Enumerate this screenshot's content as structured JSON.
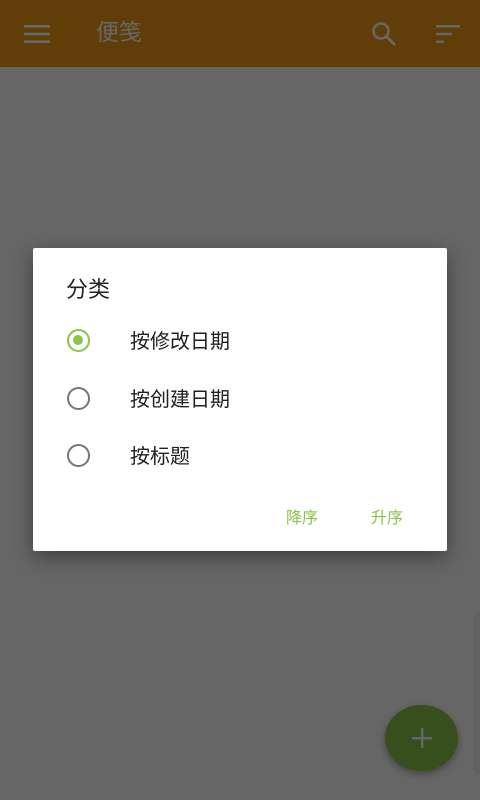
{
  "appbar": {
    "title": "便笺",
    "menu_icon": "hamburger-menu-icon",
    "search_icon": "search-icon",
    "sort_icon": "sort-icon"
  },
  "fab": {
    "icon": "plus-icon"
  },
  "dialog": {
    "title": "分类",
    "options": [
      {
        "label": "按修改日期",
        "selected": true
      },
      {
        "label": "按创建日期",
        "selected": false
      },
      {
        "label": "按标题",
        "selected": false
      }
    ],
    "buttons": {
      "descending": "降序",
      "ascending": "升序"
    }
  },
  "colors": {
    "appbar": "#f39c12",
    "accent": "#8bc34a",
    "scrim": "rgba(0,0,0,0.6)"
  }
}
